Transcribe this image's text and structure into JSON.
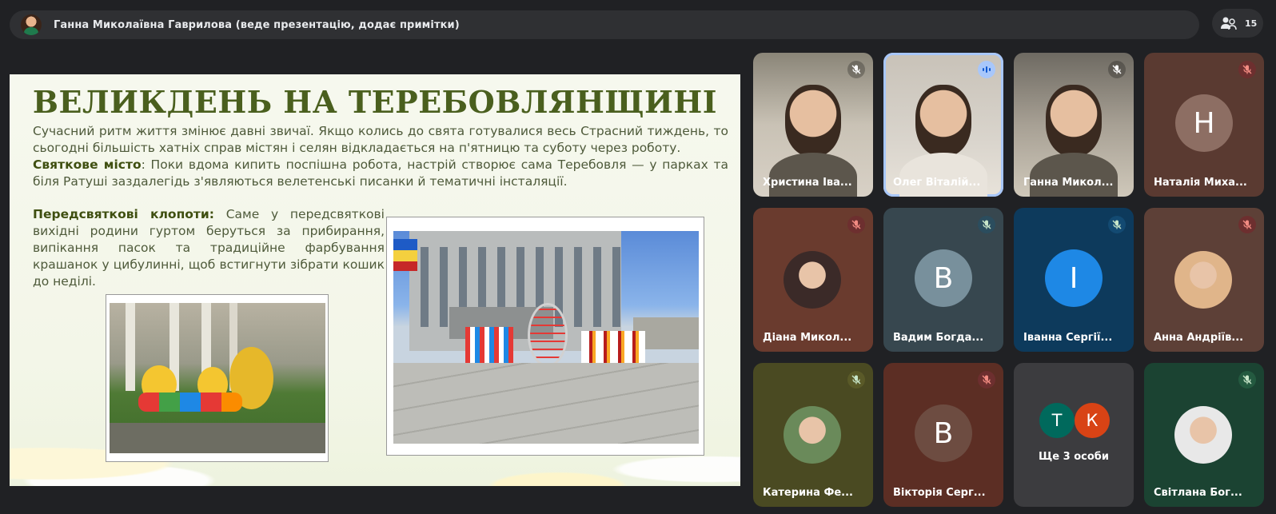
{
  "topbar": {
    "presenter_name": "Ганна Миколаївна Гаврилова (веде презентацію, додає примітки)",
    "participant_count": "15"
  },
  "slide": {
    "title": "ВЕЛИКДЕНЬ НА ТЕРЕБОВЛЯНЩИНІ",
    "para1": "Сучасний ритм життя змінює давні звичаї. Якщо колись до свята готувалися весь Страсний тиждень, то сьогодні більшість хатніх справ містян і селян відкладається на п'ятницю та суботу через роботу.",
    "para2_bold": "Святкове місто",
    "para2": ": Поки вдома кипить поспішна робота, настрій створює сама Теребовля — у парках та біля Ратуші заздалегідь з'являються велетенські писанки й тематичні інсталяції.",
    "para3_bold": "Передсвяткові клопоти:",
    "para3": " Саме у передсвяткові вихідні родини гуртом беруться за прибирання, випікання пасок та традиційне фарбування крашанок у цибулинні, щоб встигнути зібрати кошик до неділі."
  },
  "participants": [
    {
      "name": "Христина Іва...",
      "mic": "muted"
    },
    {
      "name": "Олег Віталій...",
      "mic": "speaking"
    },
    {
      "name": "Ганна Микол...",
      "mic": "muted"
    },
    {
      "name": "Наталія Миха...",
      "mic": "muted",
      "letter": "Н"
    },
    {
      "name": "Діана Микол...",
      "mic": "muted"
    },
    {
      "name": "Вадим Богда...",
      "mic": "muted",
      "letter": "В"
    },
    {
      "name": "Іванна Сергії...",
      "mic": "muted",
      "letter": "І"
    },
    {
      "name": "Анна Андріїв...",
      "mic": "muted"
    },
    {
      "name": "Катерина Фе...",
      "mic": "muted"
    },
    {
      "name": "Вікторія Серг...",
      "mic": "muted",
      "letter": "В"
    },
    {
      "name": "Ще 3 особи",
      "letters": [
        "Т",
        "К"
      ]
    },
    {
      "name": "Світлана Бог...",
      "mic": "muted"
    }
  ],
  "colors": {
    "background": "#202124",
    "speaking_border": "#a8c7fa",
    "slide_title": "#4a5f1e"
  }
}
